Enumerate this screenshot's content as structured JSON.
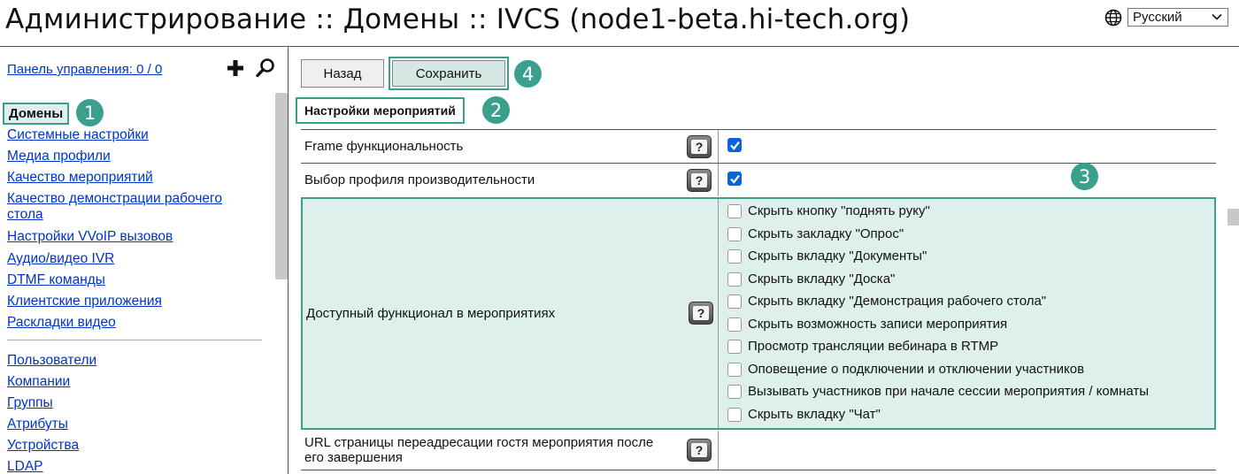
{
  "title": "Администрирование :: Домены :: IVCS (node1-beta.hi-tech.org)",
  "language": {
    "selected": "Русский"
  },
  "sidebar": {
    "panel_link": "Панель управления: 0 / 0",
    "active_item": "Домены",
    "items": [
      "Системные настройки",
      "Медиа профили",
      "Качество мероприятий",
      "Качество демонстрации рабочего стола",
      "Настройки VVoIP вызовов",
      "Аудио/видео IVR",
      "DTMF команды",
      "Клиентские приложения",
      "Раскладки видео"
    ],
    "items2": [
      "Пользователи",
      "Компании",
      "Группы",
      "Атрибуты",
      "Устройства",
      "LDAP"
    ]
  },
  "toolbar": {
    "back_label": "Назад",
    "save_label": "Сохранить"
  },
  "section": {
    "title": "Настройки мероприятий"
  },
  "rows": [
    {
      "label": "Frame функциональность",
      "checked": true
    },
    {
      "label": "Выбор профиля производительности",
      "checked": true
    },
    {
      "label": "Доступный функционал в мероприятиях"
    },
    {
      "label": "URL страницы переадресации гостя мероприятия после его завершения"
    }
  ],
  "help_label": "?",
  "features": [
    "Скрыть кнопку \"поднять руку\"",
    "Скрыть закладку \"Опрос\"",
    "Скрыть вкладку \"Документы\"",
    "Скрыть вкладку \"Доска\"",
    "Скрыть вкладку \"Демонстрация рабочего стола\"",
    "Скрыть возможность записи мероприятия",
    "Просмотр трансляции вебинара в RTMP",
    "Оповещение о подключении и отключении участников",
    "Вызывать участников при начале сессии мероприятия / комнаты",
    "Скрыть вкладку \"Чат\""
  ],
  "badges": [
    "1",
    "2",
    "3",
    "4"
  ],
  "colors": {
    "accent": "#3aa08e",
    "highlight": "#dff0ec",
    "link": "#0033cc",
    "checkbox": "#0a64d8"
  },
  "icons": [
    "globe-icon",
    "plus-icon",
    "search-icon",
    "help-icon",
    "checkmark-icon"
  ]
}
